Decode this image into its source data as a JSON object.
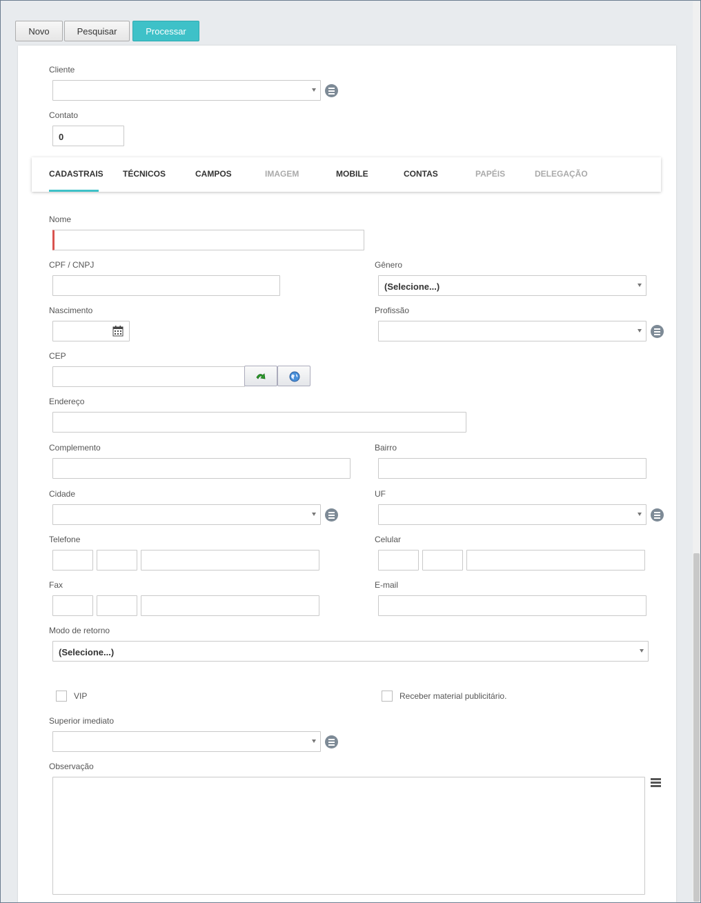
{
  "toolbar": {
    "novo": "Novo",
    "pesquisar": "Pesquisar",
    "processar": "Processar",
    "accent_color": "#3ec1c8"
  },
  "header": {
    "cliente_label": "Cliente",
    "cliente_value": "",
    "contato_label": "Contato",
    "contato_value": "0"
  },
  "tabs": [
    {
      "label": "CADASTRAIS",
      "active": true,
      "enabled": true
    },
    {
      "label": "TÉCNICOS",
      "active": false,
      "enabled": true
    },
    {
      "label": "CAMPOS",
      "active": false,
      "enabled": true
    },
    {
      "label": "IMAGEM",
      "active": false,
      "enabled": false
    },
    {
      "label": "MOBILE",
      "active": false,
      "enabled": true
    },
    {
      "label": "CONTAS",
      "active": false,
      "enabled": true
    },
    {
      "label": "PAPÉIS",
      "active": false,
      "enabled": false
    },
    {
      "label": "DELEGAÇÃO",
      "active": false,
      "enabled": false
    }
  ],
  "form": {
    "nome": "Nome",
    "cpf": "CPF / CNPJ",
    "genero": "Gênero",
    "genero_value": "(Selecione...)",
    "nascimento": "Nascimento",
    "profissao": "Profissão",
    "cep": "CEP",
    "endereco": "Endereço",
    "complemento": "Complemento",
    "bairro": "Bairro",
    "cidade": "Cidade",
    "uf": "UF",
    "telefone": "Telefone",
    "celular": "Celular",
    "fax": "Fax",
    "email": "E-mail",
    "modo_retorno": "Modo de retorno",
    "modo_retorno_value": "(Selecione...)",
    "vip": "VIP",
    "receber": "Receber material publicitário.",
    "superior": "Superior imediato",
    "observacao": "Observação"
  },
  "icons": {
    "list": "list-icon",
    "calendar": "calendar-icon",
    "refresh": "green-arrow-icon",
    "globe": "globe-icon",
    "menu": "hamburger-icon"
  }
}
